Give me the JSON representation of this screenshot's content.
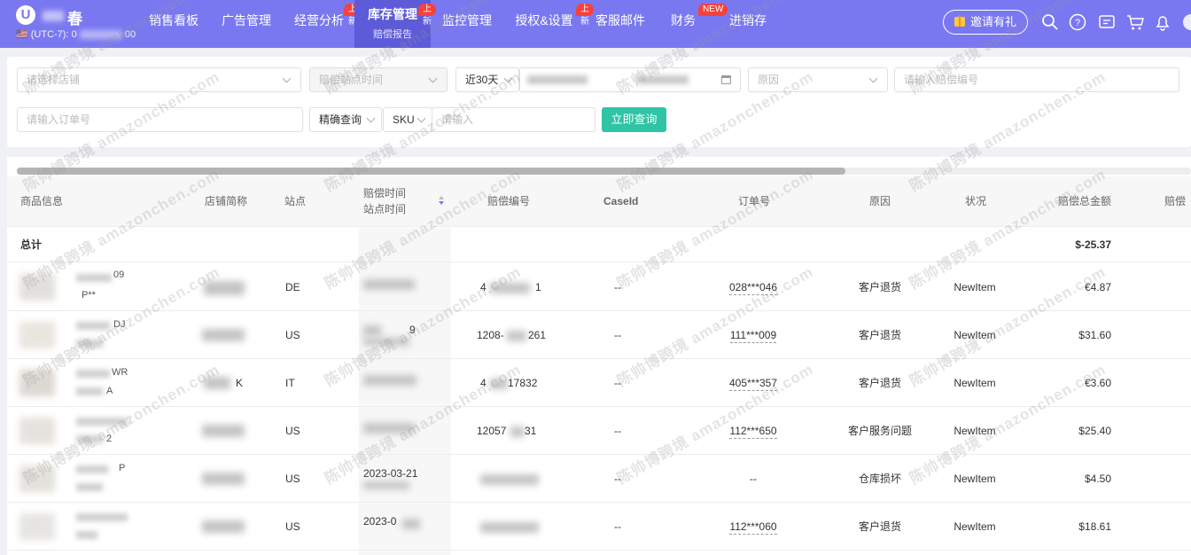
{
  "brand": {
    "logo_letter": "U",
    "name_fragment": "春",
    "timezone_prefix": "🇺🇸 (UTC-7): 0",
    "timezone_suffix": "00"
  },
  "nav": {
    "items": [
      {
        "label": "销售看板"
      },
      {
        "label": "广告管理"
      },
      {
        "label": "经营分析",
        "badge": "上新"
      },
      {
        "label": "库存管理",
        "sub": "赔偿报告",
        "badge": "上新",
        "active": true
      },
      {
        "label": "监控管理"
      },
      {
        "label": "授权&设置",
        "badge": "上新"
      },
      {
        "label": "客服邮件"
      },
      {
        "label": "财务",
        "badge": "NEW"
      },
      {
        "label": "进销存"
      }
    ],
    "invite_label": "邀请有礼",
    "icons": [
      "search-icon",
      "help-icon",
      "message-icon",
      "cart-icon",
      "bell-icon",
      "avatar"
    ]
  },
  "filters": {
    "store_placeholder": "请选择店铺",
    "compensation_time_placeholder": "赔偿站点时间",
    "date_range": "近30天",
    "reason_placeholder": "原因",
    "compensation_id_placeholder": "请输入赔偿编号",
    "order_id_placeholder": "请输入订单号",
    "match_mode": "精确查询",
    "field_type": "SKU",
    "keyword_placeholder": "请输入",
    "query_button": "立即查询"
  },
  "table": {
    "headers": {
      "product": "商品信息",
      "store": "店铺简称",
      "site": "站点",
      "time_line1": "赔偿时间",
      "time_line2": "站点时间",
      "comp_id": "赔偿编号",
      "case_id": "CaseId",
      "order_id": "订单号",
      "reason": "原因",
      "status": "状况",
      "amount": "赔偿总金额",
      "more": "赔偿"
    },
    "total_label": "总计",
    "total_amount": "$-25.37",
    "rows": [
      {
        "site": "DE",
        "comp_prefix": "4",
        "comp_suffix": "1",
        "case": "--",
        "order": "028***046",
        "reason": "客户退货",
        "status": "NewItem",
        "amount": "€4.87",
        "name_a": "09",
        "name_b": "P**"
      },
      {
        "site": "US",
        "comp_prefix": "1208-",
        "comp_suffix": "261",
        "case": "--",
        "order": "111***009",
        "reason": "客户退货",
        "status": "NewItem",
        "amount": "$31.60",
        "name_a": "DJ",
        "time_frag": "9"
      },
      {
        "site": "IT",
        "comp_prefix": "4",
        "comp_suffix": "17832",
        "case": "--",
        "order": "405***357",
        "reason": "客户退货",
        "status": "NewItem",
        "amount": "€3.60",
        "name_a": "WR",
        "name_b": "A",
        "store_frag": "K"
      },
      {
        "site": "US",
        "comp_prefix": "12057",
        "comp_suffix": "31",
        "case": "--",
        "order": "112***650",
        "reason": "客户服务问题",
        "status": "NewItem",
        "amount": "$25.40",
        "name_b": "2"
      },
      {
        "site": "US",
        "comp_prefix": "",
        "comp_suffix": "",
        "case": "--",
        "order": "--",
        "reason": "仓库损坏",
        "status": "NewItem",
        "amount": "$4.50",
        "name_a": "P",
        "time_frag": "2023-03-21"
      },
      {
        "site": "US",
        "comp_prefix": "",
        "comp_suffix": "",
        "case": "--",
        "order": "112***060",
        "reason": "客户退货",
        "status": "NewItem",
        "amount": "$18.61",
        "time_frag": "2023-0"
      }
    ]
  },
  "watermark": "陈帅博跨境 amazonchen.com",
  "colors": {
    "nav_bg": "#7a78f0",
    "nav_active": "#5e5bd9",
    "badge_red": "#f5423c",
    "query_button": "#2ec4a5"
  }
}
